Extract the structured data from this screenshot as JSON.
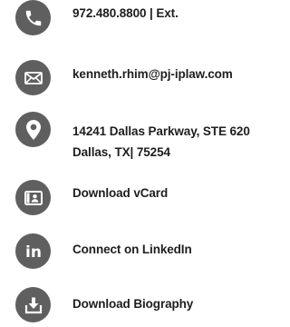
{
  "contact": {
    "phone": {
      "text": "972.480.8800 | Ext.",
      "icon": "phone-icon"
    },
    "email": {
      "text": "kenneth.rhim@pj-iplaw.com",
      "icon": "envelope-icon"
    },
    "address": {
      "line1": "14241 Dallas Parkway, STE 620",
      "line2": "Dallas, TX| 75254",
      "icon": "map-pin-icon"
    },
    "vcard": {
      "text": "Download vCard",
      "icon": "vcard-icon"
    },
    "linkedin": {
      "text": "Connect on LinkedIn",
      "icon": "linkedin-icon",
      "icon_text": "in"
    },
    "biography": {
      "text": "Download Biography",
      "icon": "download-icon"
    }
  },
  "colors": {
    "icon_circle": "#5f5f5f",
    "icon_glyph": "#ffffff",
    "text": "#1e1e1e"
  }
}
